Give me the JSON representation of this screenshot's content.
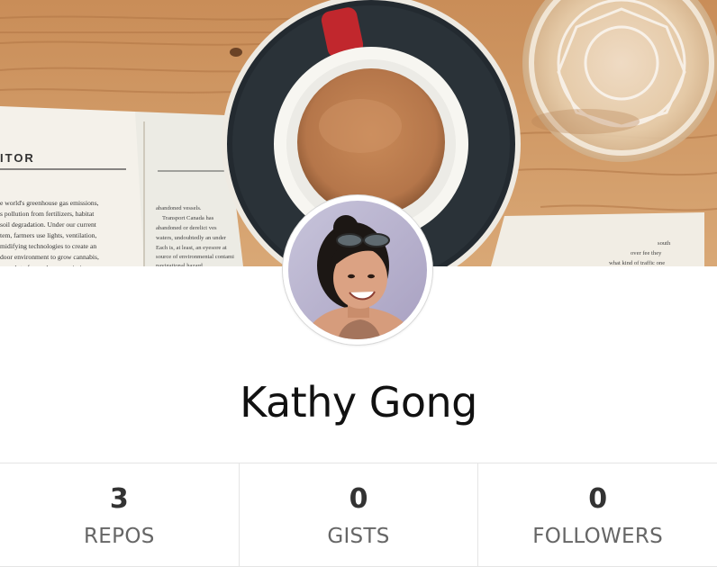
{
  "profile": {
    "name": "Kathy Gong"
  },
  "cover": {
    "book_heading": "ITOR",
    "book_lines_left": [
      "e world's greenhouse gas emissions,",
      "s pollution from fertilizers, habitat",
      "soil degradation. Under our current",
      "tem, farmers use lights, ventilation,",
      "midifying technologies to create an",
      "door environment to grow cannabis,",
      "ses a lot of greenhouse emissions."
    ],
    "book_lines_right": [
      "abandoned vessels.",
      "Transport Canada has",
      "abandoned or derelict ves",
      "waters, undoubtedly an under",
      "Each is, at least, an eyesore at",
      "source of environmental contami",
      "navigational hazard."
    ],
    "book_lines_far_right": [
      "south",
      "over fee they",
      "what kind of traffic one"
    ]
  },
  "stats": [
    {
      "count": "3",
      "label": "REPOS"
    },
    {
      "count": "0",
      "label": "GISTS"
    },
    {
      "count": "0",
      "label": "FOLLOWERS"
    }
  ],
  "colors": {
    "name_text": "#111111",
    "count_text": "#333333",
    "label_text": "#666666",
    "divider": "#e5e5e5"
  }
}
